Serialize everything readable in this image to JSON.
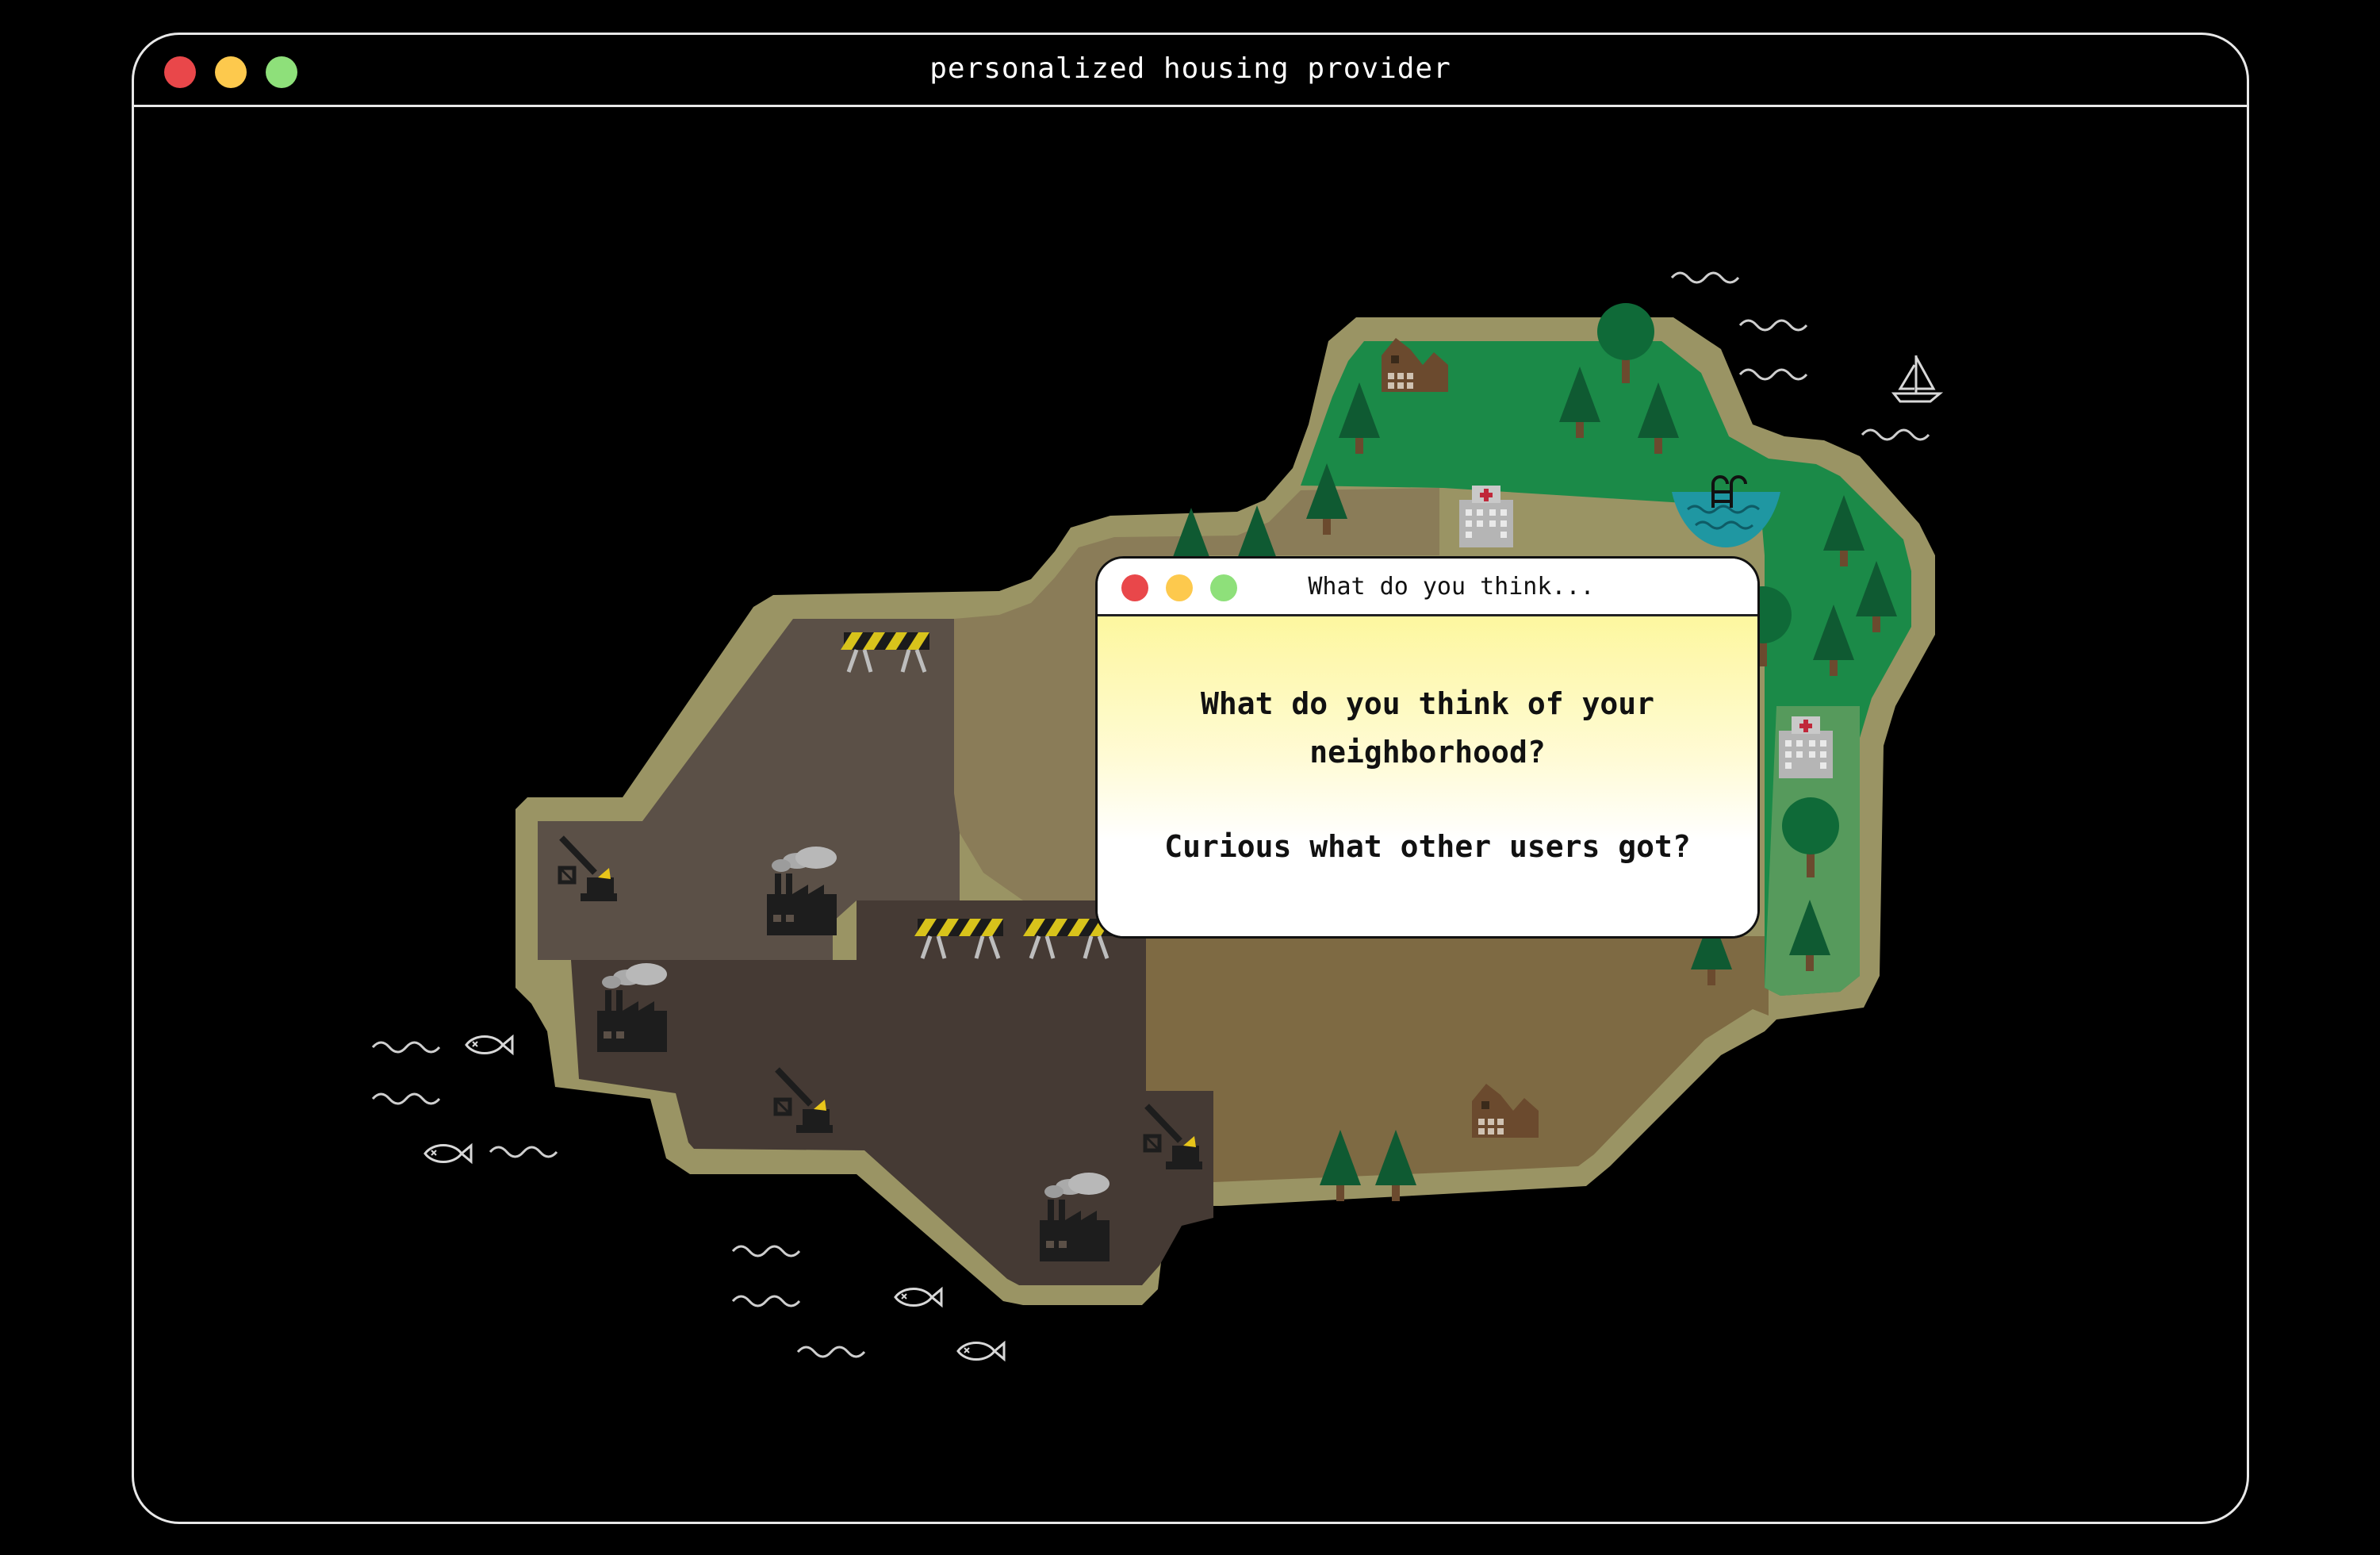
{
  "window": {
    "title": "personalized housing provider",
    "controls": {
      "close_color": "#e9474a",
      "minimize_color": "#fdc94d",
      "maximize_color": "#8ee07a"
    }
  },
  "dialog": {
    "title": "What do you think...",
    "question": "What do you think of your neighborhood?",
    "prompt": "Curious what other users got?",
    "controls": {
      "close_color": "#e9474a",
      "minimize_color": "#fdc94d",
      "maximize_color": "#8ee07a"
    }
  },
  "map": {
    "zones": [
      {
        "name": "industrial",
        "colors": [
          "#5b5047",
          "#453a34"
        ]
      },
      {
        "name": "residential",
        "colors": [
          "#8a7c58",
          "#7e6a43"
        ]
      },
      {
        "name": "park",
        "colors": [
          "#1b8a48",
          "#569a5c"
        ]
      }
    ],
    "icons": [
      "factory-icon",
      "crane-icon",
      "road-barrier-icon",
      "house-icon",
      "hospital-icon",
      "pine-tree-icon",
      "round-tree-icon",
      "swimming-pool-icon",
      "sailboat-icon",
      "fish-icon",
      "wave-icon"
    ]
  }
}
